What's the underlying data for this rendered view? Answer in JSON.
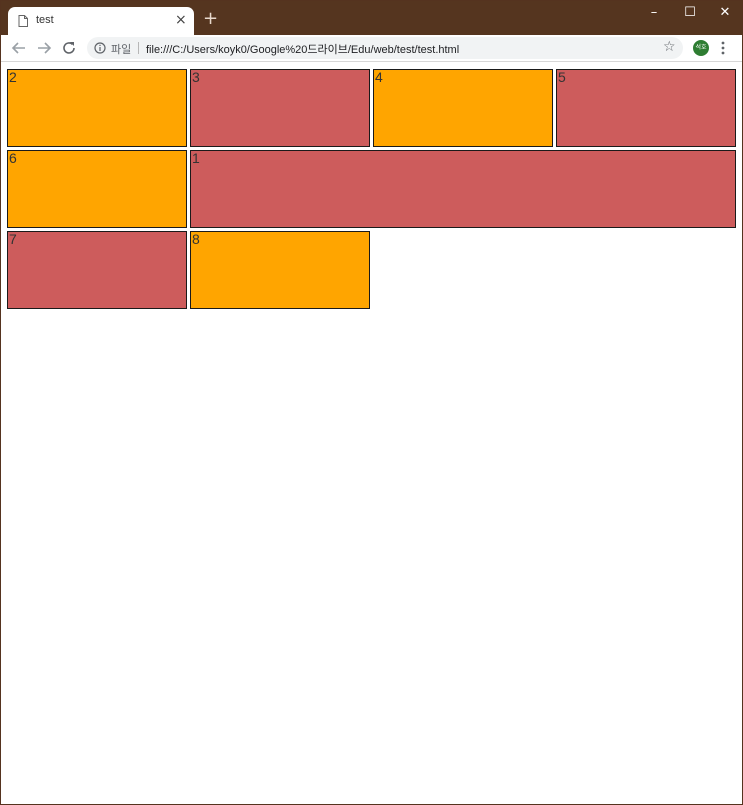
{
  "browser": {
    "tab": {
      "title": "test",
      "close_label": "×"
    },
    "new_tab_label": "+",
    "window_controls": {
      "minimize": "–",
      "maximize": "☐",
      "close": "✕"
    },
    "omnibox": {
      "security_label": "파일",
      "url": "file:///C:/Users/koyk0/Google%20드라이브/Edu/web/test/test.html"
    },
    "profile_initials": "석호",
    "icons": [
      "page-icon",
      "back-icon",
      "forward-icon",
      "reload-icon",
      "info-icon",
      "star-icon",
      "kebab-menu-icon"
    ]
  },
  "page": {
    "boxes": [
      {
        "label": "2",
        "color": "#ffa500"
      },
      {
        "label": "3",
        "color": "#cd5c5c"
      },
      {
        "label": "4",
        "color": "#ffa500"
      },
      {
        "label": "5",
        "color": "#cd5c5c"
      },
      {
        "label": "6",
        "color": "#ffa500"
      },
      {
        "label": "1",
        "color": "#cd5c5c"
      },
      {
        "label": "7",
        "color": "#cd5c5c"
      },
      {
        "label": "8",
        "color": "#ffa500"
      }
    ]
  },
  "colors": {
    "titlebar": "#55351f",
    "orange": "#ffa500",
    "indianred": "#cd5c5c"
  }
}
